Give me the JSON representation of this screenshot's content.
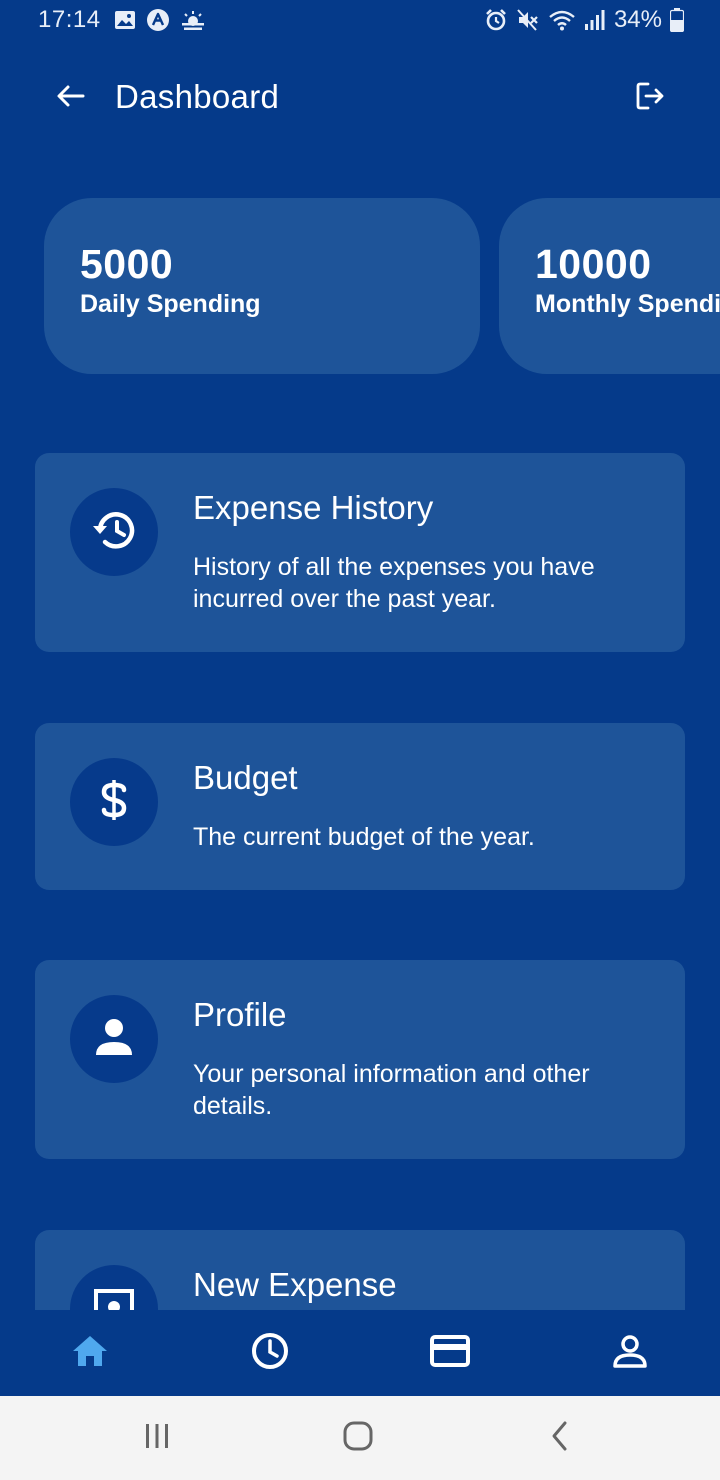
{
  "status_bar": {
    "time": "17:14",
    "battery": "34%",
    "left_icons": [
      "image-icon",
      "app-notification-icon",
      "weather-icon"
    ],
    "right_icons": [
      "alarm-icon",
      "mute-icon",
      "wifi-icon",
      "signal-icon",
      "battery-icon"
    ]
  },
  "header": {
    "title": "Dashboard",
    "back_icon": "arrow-left-icon",
    "logout_icon": "logout-icon"
  },
  "summary_cards": [
    {
      "value": "5000",
      "label": "Daily Spending"
    },
    {
      "value": "10000",
      "label": "Monthly Spending"
    }
  ],
  "menu": [
    {
      "icon": "history-icon",
      "title": "Expense History",
      "description": "History of all the expenses you have incurred over the past year."
    },
    {
      "icon": "dollar-icon",
      "title": "Budget",
      "description": "The current budget of the year."
    },
    {
      "icon": "person-icon",
      "title": "Profile",
      "description": "Your personal information and other details."
    },
    {
      "icon": "receipt-icon",
      "title": "New Expense",
      "description": ""
    }
  ],
  "bottom_nav": {
    "items": [
      "home-icon",
      "clock-icon",
      "card-icon",
      "account-icon"
    ],
    "active_index": 0
  },
  "colors": {
    "background": "#053a8a",
    "card": "#1e5499",
    "icon_circle": "#063a8b",
    "active_nav": "#4fa8ee",
    "text": "#ffffff",
    "system_nav_bg": "#f4f4f4"
  }
}
